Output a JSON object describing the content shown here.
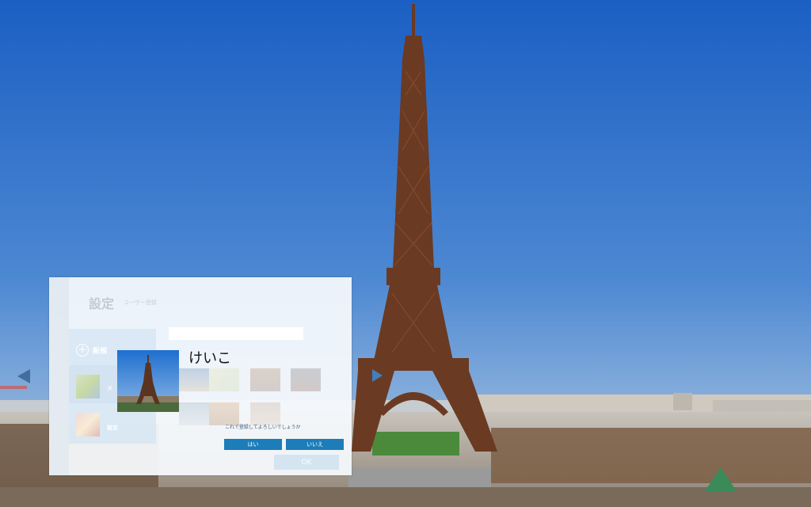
{
  "settings": {
    "title": "設定",
    "subtitle": "ユーザー登録",
    "new_user_label": "新規",
    "users": [
      {
        "name": "メ",
        "thumb": "user-photo-1"
      },
      {
        "name": "設定",
        "thumb": "user-photo-2"
      }
    ],
    "name_input_value": "",
    "ok_label": "OK"
  },
  "confirm": {
    "user_name": "けいこ",
    "message": "これで登録してよろしいでしょうか",
    "yes_label": "はい",
    "no_label": "いいえ"
  },
  "icons": {
    "plus": "plus-circle-icon",
    "prev": "arrow-left-icon",
    "next": "arrow-right-icon"
  },
  "colors": {
    "sky_top": "#1b5fc4",
    "sky_bottom": "#7da8d8",
    "tower": "#6b3a22",
    "button_blue": "#1c7db8"
  }
}
